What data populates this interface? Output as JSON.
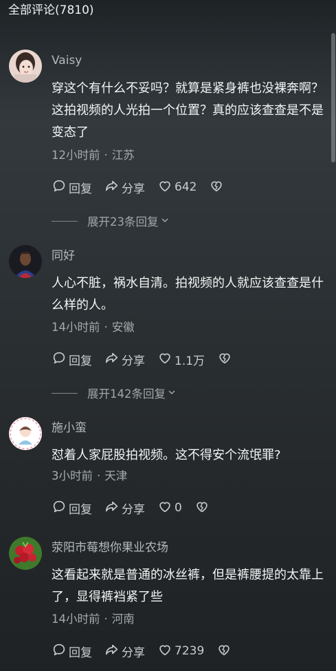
{
  "header": {
    "title": "全部评论(7810)"
  },
  "comments": [
    {
      "username": "Vaisy",
      "content": "穿这个有什么不妥吗？就算是紧身裤也没裸奔啊？这拍视频的人光拍一个位置？真的应该查查是不是变态了",
      "time": "12小时前",
      "location": "江苏",
      "reply_label": "回复",
      "share_label": "分享",
      "likes": "642",
      "expand_label": "展开23条回复"
    },
    {
      "username": "同好",
      "content": "人心不脏，祸水自清。拍视频的人就应该查查是什么样的人。",
      "time": "14小时前",
      "location": "安徽",
      "reply_label": "回复",
      "share_label": "分享",
      "likes": "1.1万",
      "expand_label": "展开142条回复"
    },
    {
      "username": "施小蛮",
      "content": "怼着人家屁股拍视频。这不得安个流氓罪?",
      "time": "3小时前",
      "location": "天津",
      "reply_label": "回复",
      "share_label": "分享",
      "likes": "0"
    },
    {
      "username": "荥阳市莓想你果业农场",
      "content": "这看起来就是普通的冰丝裤，但是裤腰提的太靠上了，显得裤裆紧了些",
      "time": "14小时前",
      "location": "河南",
      "reply_label": "回复",
      "share_label": "分享",
      "likes": "7239"
    }
  ],
  "icons": {
    "reply": "speech-bubble-icon",
    "share": "share-arrow-icon",
    "like": "heart-icon",
    "dislike": "broken-heart-icon",
    "expand": "chevron-down-icon"
  },
  "colors": {
    "background_top": "#1e2426",
    "text_primary": "#f3f5f6",
    "text_secondary": "#a4abae"
  }
}
